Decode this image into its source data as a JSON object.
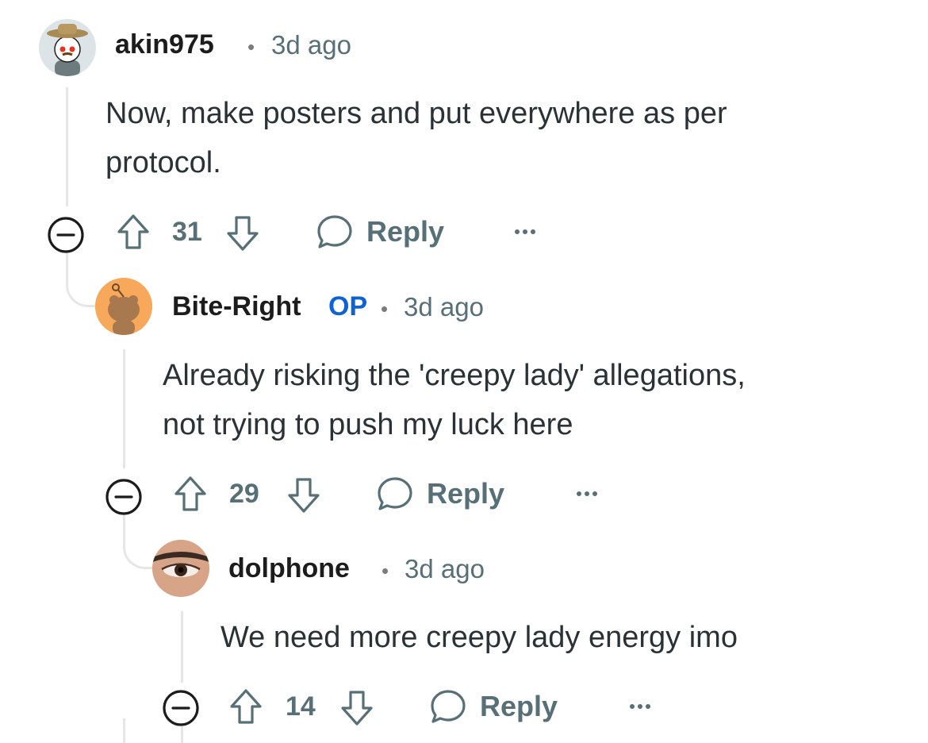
{
  "comments": [
    {
      "username": "akin975",
      "op_badge": "",
      "separator": "•",
      "time": "3d ago",
      "body_lines": [
        "Now, make posters and put everywhere as per",
        "protocol."
      ],
      "votes": "31",
      "reply_label": "Reply",
      "avatar": "snoo-cowboy-avatar"
    },
    {
      "username": "Bite-Right",
      "op_badge": "OP",
      "separator": "•",
      "time": "3d ago",
      "body_lines": [
        "Already risking the 'creepy lady' allegations,",
        "not trying to push my luck here"
      ],
      "votes": "29",
      "reply_label": "Reply",
      "avatar": "snoo-orange-avatar"
    },
    {
      "username": "dolphone",
      "op_badge": "",
      "separator": "•",
      "time": "3d ago",
      "body_lines": [
        "We need more creepy lady energy imo"
      ],
      "votes": "14",
      "reply_label": "Reply",
      "avatar": "eye-photo-avatar"
    }
  ],
  "icons": {
    "collapse": "collapse-minus-icon",
    "upvote": "upvote-arrow-icon",
    "downvote": "downvote-arrow-icon",
    "reply": "speech-bubble-icon",
    "more": "more-options-icon"
  },
  "colors": {
    "text": "#2a3236",
    "meta": "#576f76",
    "op": "#0f62d6",
    "thread": "#e4e6e8"
  }
}
